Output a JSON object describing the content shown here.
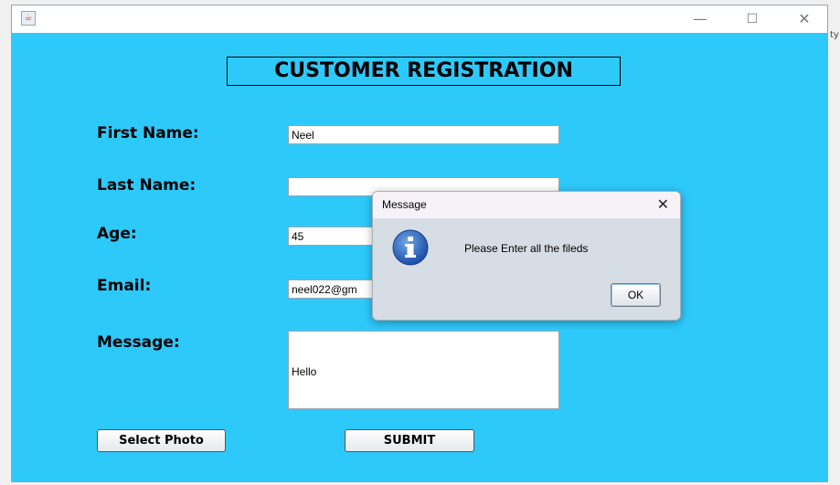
{
  "window": {
    "controls": {
      "minimize": "—",
      "maximize": "☐",
      "close": "✕"
    },
    "side_glyph": "ty"
  },
  "form": {
    "title": "CUSTOMER REGISTRATION",
    "labels": {
      "first_name": "First Name:",
      "last_name": "Last Name:",
      "age": "Age:",
      "email": "Email:",
      "message": "Message:"
    },
    "values": {
      "first_name": "Neel",
      "last_name": "",
      "age": "45",
      "email": "neel022@gm",
      "message": "Hello"
    },
    "buttons": {
      "select_photo": "Select Photo",
      "submit": "SUBMIT"
    }
  },
  "dialog": {
    "title": "Message",
    "text": "Please Enter all the fileds",
    "ok": "OK",
    "close": "✕"
  },
  "colors": {
    "background": "#2ec9fb",
    "info_icon": "#2b68c4"
  }
}
